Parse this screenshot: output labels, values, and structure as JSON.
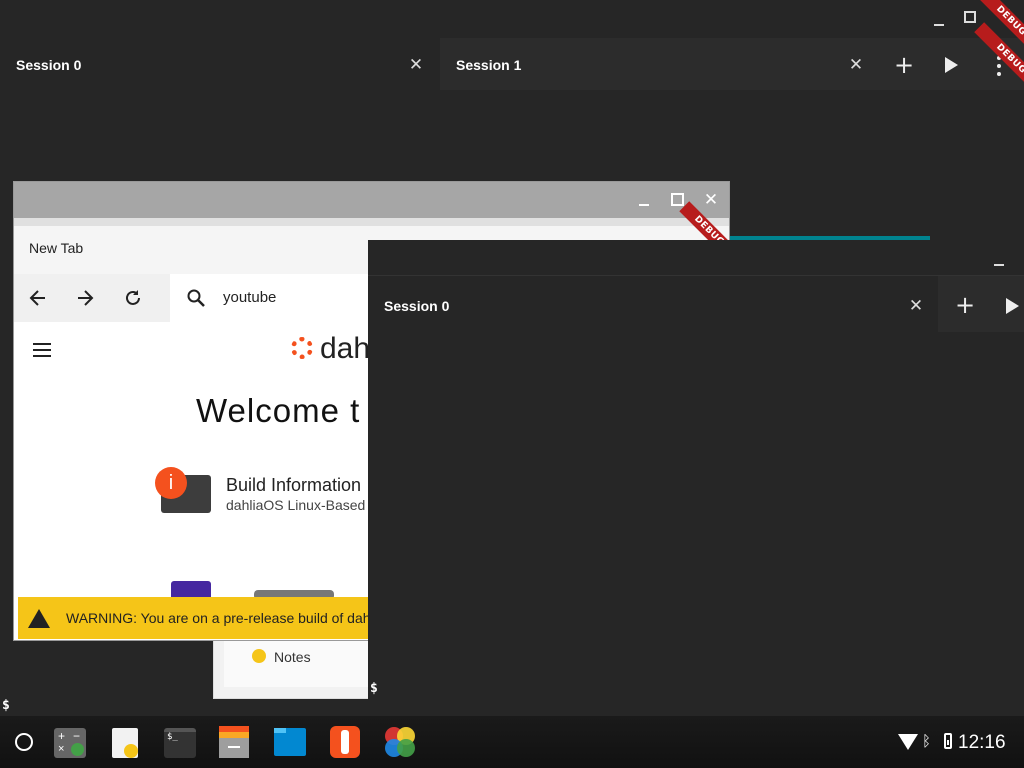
{
  "bg_terminal": {
    "tabs": [
      {
        "label": "Session 0"
      },
      {
        "label": "Session 1"
      }
    ],
    "ribbon": "DEBUG",
    "ribbon2": "DEBUG"
  },
  "browser": {
    "tab_title": "New Tab",
    "search_value": "youtube",
    "brand_text": "dahl",
    "welcome": "Welcome t",
    "build_info_title": "Build Information",
    "build_info_sub": "dahliaOS Linux-Based",
    "warning": "WARNING: You are on a pre-release build of dahli",
    "ribbon": "DEBUG"
  },
  "notes_window": {
    "label": "Notes"
  },
  "fg_terminal": {
    "tab_label": "Session 0",
    "prompt": "$"
  },
  "desktop": {
    "prompt": "$"
  },
  "taskbar": {
    "clock": "12:16"
  },
  "colors": {
    "accent_teal": "#00838f",
    "warning_yellow": "#f5c518",
    "dahlia_orange": "#f4511e",
    "debug_red": "#b71c1c"
  }
}
